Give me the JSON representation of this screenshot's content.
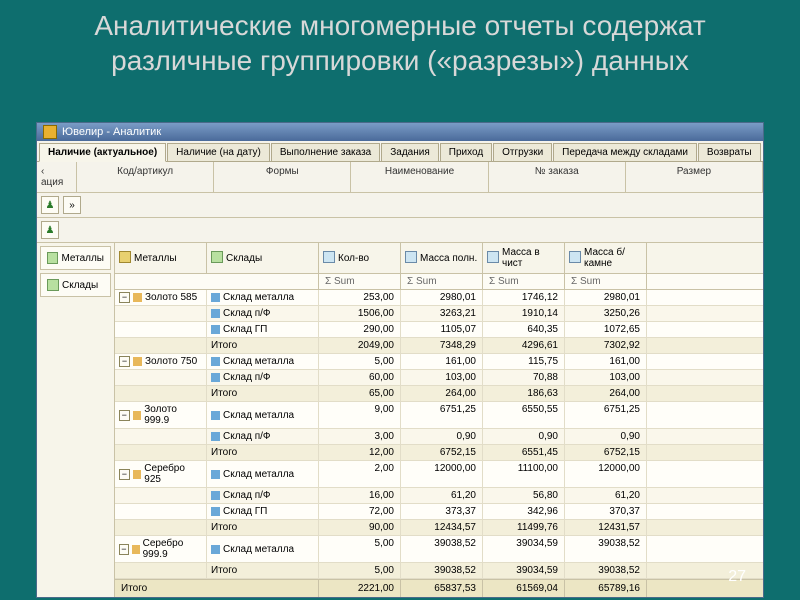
{
  "slide_title": "Аналитические многомерные отчеты содержат различные группировки («разрезы») данных",
  "app_title": "Ювелир - Аналитик",
  "tabs": [
    {
      "label": "Наличие (актуальное)",
      "active": true
    },
    {
      "label": "Наличие (на дату)"
    },
    {
      "label": "Выполнение заказа"
    },
    {
      "label": "Задания"
    },
    {
      "label": "Приход"
    },
    {
      "label": "Отгрузки"
    },
    {
      "label": "Передача между складами"
    },
    {
      "label": "Возвраты"
    }
  ],
  "fields": [
    "ация",
    "Код/артикул",
    "Формы",
    "Наименование",
    "№ заказа",
    "Размер"
  ],
  "side": {
    "item1": "Металлы",
    "item2": "Склады"
  },
  "head": {
    "metals": "Металлы",
    "sklad": "Склады",
    "c1": "Кол-во",
    "c2": "Масса полн.",
    "c3": "Масса в чист",
    "c4": "Масса б/камне"
  },
  "sum": "Σ  Sum",
  "groups": [
    {
      "metal": "Золото 585",
      "rows": [
        {
          "s": "Склад металла",
          "v": [
            "253,00",
            "2980,01",
            "1746,12",
            "2980,01"
          ]
        },
        {
          "s": "Склад п/Ф",
          "v": [
            "1506,00",
            "3263,21",
            "1910,14",
            "3250,26"
          ]
        },
        {
          "s": "Склад ГП",
          "v": [
            "290,00",
            "1105,07",
            "640,35",
            "1072,65"
          ]
        },
        {
          "s": "Итого",
          "v": [
            "2049,00",
            "7348,29",
            "4296,61",
            "7302,92"
          ],
          "total": true
        }
      ]
    },
    {
      "metal": "Золото 750",
      "rows": [
        {
          "s": "Склад металла",
          "v": [
            "5,00",
            "161,00",
            "115,75",
            "161,00"
          ]
        },
        {
          "s": "Склад п/Ф",
          "v": [
            "60,00",
            "103,00",
            "70,88",
            "103,00"
          ]
        },
        {
          "s": "Итого",
          "v": [
            "65,00",
            "264,00",
            "186,63",
            "264,00"
          ],
          "total": true
        }
      ]
    },
    {
      "metal": "Золото 999.9",
      "rows": [
        {
          "s": "Склад металла",
          "v": [
            "9,00",
            "6751,25",
            "6550,55",
            "6751,25"
          ]
        },
        {
          "s": "Склад п/Ф",
          "v": [
            "3,00",
            "0,90",
            "0,90",
            "0,90"
          ]
        },
        {
          "s": "Итого",
          "v": [
            "12,00",
            "6752,15",
            "6551,45",
            "6752,15"
          ],
          "total": true
        }
      ]
    },
    {
      "metal": "Серебро 925",
      "rows": [
        {
          "s": "Склад металла",
          "v": [
            "2,00",
            "12000,00",
            "11100,00",
            "12000,00"
          ]
        },
        {
          "s": "Склад п/Ф",
          "v": [
            "16,00",
            "61,20",
            "56,80",
            "61,20"
          ]
        },
        {
          "s": "Склад ГП",
          "v": [
            "72,00",
            "373,37",
            "342,96",
            "370,37"
          ]
        },
        {
          "s": "Итого",
          "v": [
            "90,00",
            "12434,57",
            "11499,76",
            "12431,57"
          ],
          "total": true
        }
      ]
    },
    {
      "metal": "Серебро 999.9",
      "rows": [
        {
          "s": "Склад металла",
          "v": [
            "5,00",
            "39038,52",
            "39034,59",
            "39038,52"
          ]
        },
        {
          "s": "Итого",
          "v": [
            "5,00",
            "39038,52",
            "39034,59",
            "39038,52"
          ],
          "total": true
        }
      ]
    }
  ],
  "grand": {
    "label": "Итого",
    "v": [
      "2221,00",
      "65837,53",
      "61569,04",
      "65789,16"
    ]
  },
  "page_num": "27"
}
